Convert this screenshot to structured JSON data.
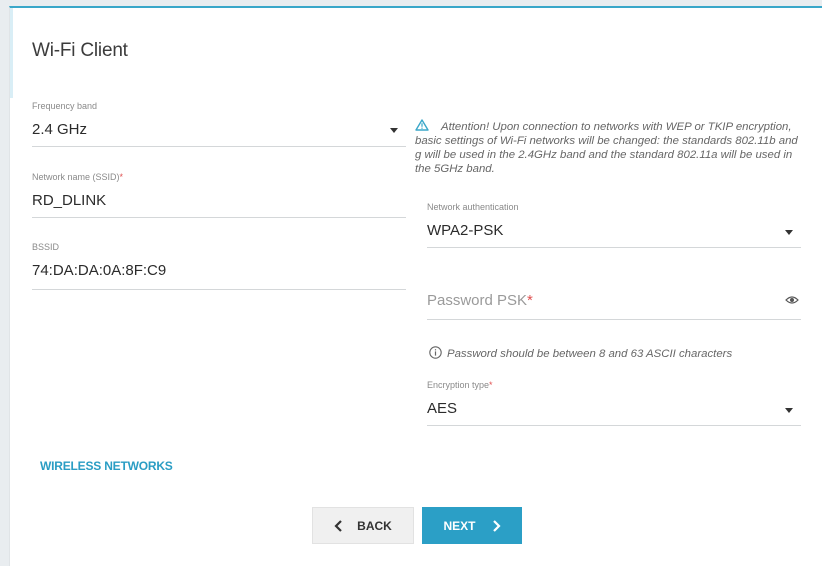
{
  "page": {
    "title": "Wi-Fi Client"
  },
  "left": {
    "frequency_band": {
      "label": "Frequency band",
      "value": "2.4 GHz"
    },
    "ssid": {
      "label": "Network name (SSID)",
      "required": "*",
      "value": "RD_DLINK"
    },
    "bssid": {
      "label": "BSSID",
      "value": "74:DA:DA:0A:8F:C9"
    }
  },
  "right": {
    "attention": "Attention! Upon connection to networks with WEP or TKIP encryption, basic settings of Wi-Fi networks will be changed: the standards 802.11b and g will be used in the 2.4GHz band and the standard 802.11a will be used in the 5GHz band.",
    "auth": {
      "label": "Network authentication",
      "value": "WPA2-PSK"
    },
    "password": {
      "placeholder": "Password PSK",
      "required": "*"
    },
    "password_hint": "Password should be between 8 and 63 ASCII characters",
    "encryption": {
      "label": "Encryption type",
      "required": "*",
      "value": "AES"
    }
  },
  "links": {
    "wireless_networks": "WIRELESS NETWORKS"
  },
  "buttons": {
    "back": "BACK",
    "next": "NEXT"
  },
  "colors": {
    "accent": "#2b9fc6",
    "warning": "#3aa7c9",
    "required": "#e05050"
  },
  "icons": {
    "warning": "warning-triangle-icon",
    "eye": "eye-icon",
    "info": "info-icon",
    "chevron_left": "chevron-left-icon",
    "chevron_right": "chevron-right-icon"
  }
}
